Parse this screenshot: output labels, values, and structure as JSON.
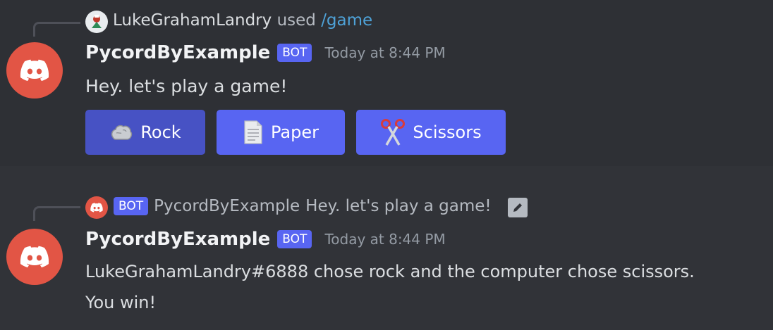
{
  "message1": {
    "reply_user": "LukeGrahamLandry",
    "reply_used": "used",
    "reply_command": "/game",
    "author": "PycordByExample",
    "bot_tag": "BOT",
    "timestamp": "Today at 8:44 PM",
    "content": "Hey. let's play a game!",
    "buttons": [
      {
        "label": "Rock",
        "icon": "rock-icon"
      },
      {
        "label": "Paper",
        "icon": "paper-icon"
      },
      {
        "label": "Scissors",
        "icon": "scissors-icon"
      }
    ]
  },
  "message2": {
    "reply_bot_tag": "BOT",
    "reply_author": "PycordByExample",
    "reply_content": "Hey. let's play a game!",
    "author": "PycordByExample",
    "bot_tag": "BOT",
    "timestamp": "Today at 8:44 PM",
    "content_line1": "LukeGrahamLandry#6888 chose rock and the computer chose scissors.",
    "content_line2": "You win!"
  },
  "colors": {
    "background": "#313338",
    "accent": "#5865f2",
    "avatar": "#e25545",
    "command": "#4ea2d8"
  }
}
